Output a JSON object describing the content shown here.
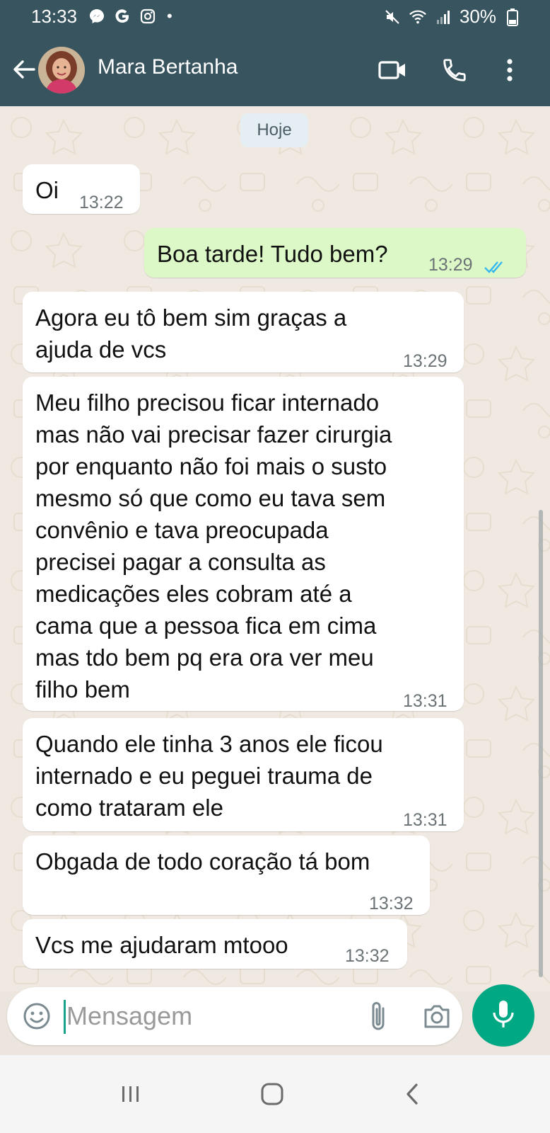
{
  "status_bar": {
    "time": "13:33",
    "notification_icons": [
      "messenger-icon",
      "google-icon",
      "instagram-icon"
    ],
    "dot": "•",
    "battery": "30%"
  },
  "header": {
    "contact_name": "Mara Bertanha",
    "color": "#37545f"
  },
  "chat": {
    "date_label": "Hoje",
    "messages": [
      {
        "direction": "in",
        "text": "Oi",
        "time": "13:22"
      },
      {
        "direction": "out",
        "text": "Boa tarde! Tudo bem?",
        "time": "13:29",
        "status": "read"
      },
      {
        "direction": "in",
        "text": "Agora eu tô bem sim graças a\najuda de vcs",
        "time": "13:29"
      },
      {
        "direction": "in",
        "text": "Meu filho precisou ficar internado\nmas não vai precisar fazer cirurgia\npor enquanto não foi mais o susto\nmesmo só que como eu tava sem\nconvênio e tava preocupada\nprecisei pagar a consulta as\nmedicações eles cobram até a\ncama que a pessoa fica em cima\nmas tdo bem pq era ora ver meu\nfilho bem",
        "time": "13:31"
      },
      {
        "direction": "in",
        "text": "Quando ele tinha 3 anos ele ficou\ninternado e eu peguei trauma de\ncomo trataram ele",
        "time": "13:31"
      },
      {
        "direction": "in",
        "text": "Obgada de todo coração tá bom",
        "time": "13:32"
      },
      {
        "direction": "in",
        "text": "Vcs me ajudaram mtooo",
        "time": "13:32"
      }
    ],
    "colors": {
      "incoming": "#ffffff",
      "outgoing": "#dcf8c6",
      "read_ticks": "#34b7f1"
    }
  },
  "composer": {
    "placeholder": "Mensagem",
    "mic_color": "#00a884"
  }
}
